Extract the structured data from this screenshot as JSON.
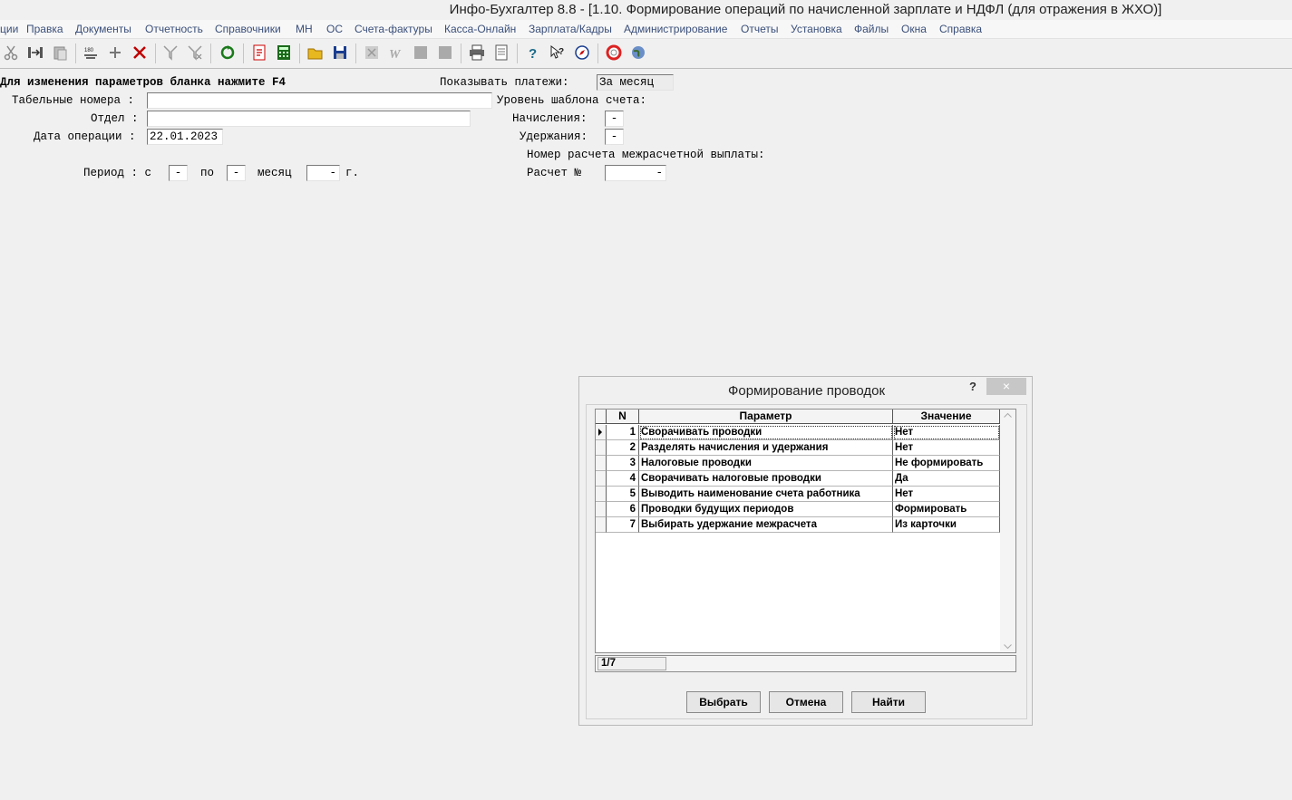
{
  "window": {
    "title": "Инфо-Бухгалтер 8.8 - [1.10. Формирование операций по начисленной зарплате и НДФЛ (для отражения в ЖХО)]"
  },
  "menu": [
    "ции",
    "Правка",
    "Документы",
    "Отчетность",
    "Справочники",
    "МН",
    "ОС",
    "Счета-фактуры",
    "Касса-Онлайн",
    "Зарплата/Кадры",
    "Администрирование",
    "Отчеты",
    "Установка",
    "Файлы",
    "Окна",
    "Справка"
  ],
  "form": {
    "hint": "Для изменения параметров бланка нажмите F4",
    "tab_label": "Табельные номера :",
    "tab_value": "",
    "dept_label": "Отдел :",
    "dept_value": "",
    "date_label": "Дата операции :",
    "date_value": "22.01.2023",
    "period_label": "Период : с",
    "period_from": "-",
    "period_to_label": "по",
    "period_to": "-",
    "month_label": "месяц",
    "year_value": "-",
    "year_suffix": "г.",
    "show_payments_label": "Показывать платежи:",
    "show_payments_value": "За месяц",
    "template_level_label": "Уровень шаблона счета:",
    "accruals_label": "Начисления:",
    "accruals_value": "-",
    "deductions_label": "Удержания:",
    "deductions_value": "-",
    "interpay_label": "Номер расчета межрасчетной выплаты:",
    "calc_label": "Расчет №",
    "calc_value": "-"
  },
  "dialog": {
    "title": "Формирование проводок",
    "help": "?",
    "close": "×",
    "columns": {
      "n": "N",
      "param": "Параметр",
      "value": "Значение"
    },
    "rows": [
      {
        "n": "1",
        "param": "Сворачивать проводки",
        "value": "Нет"
      },
      {
        "n": "2",
        "param": "Разделять начисления и удержания",
        "value": "Нет"
      },
      {
        "n": "3",
        "param": "Налоговые проводки",
        "value": "Не формировать"
      },
      {
        "n": "4",
        "param": "Сворачивать налоговые проводки",
        "value": "Да"
      },
      {
        "n": "5",
        "param": "Выводить наименование счета работника",
        "value": "Нет"
      },
      {
        "n": "6",
        "param": "Проводки будущих периодов",
        "value": "Формировать"
      },
      {
        "n": "7",
        "param": "Выбирать удержание межрасчета",
        "value": "Из карточки"
      }
    ],
    "status": "1/7",
    "buttons": {
      "select": "Выбрать",
      "cancel": "Отмена",
      "find": "Найти"
    }
  }
}
